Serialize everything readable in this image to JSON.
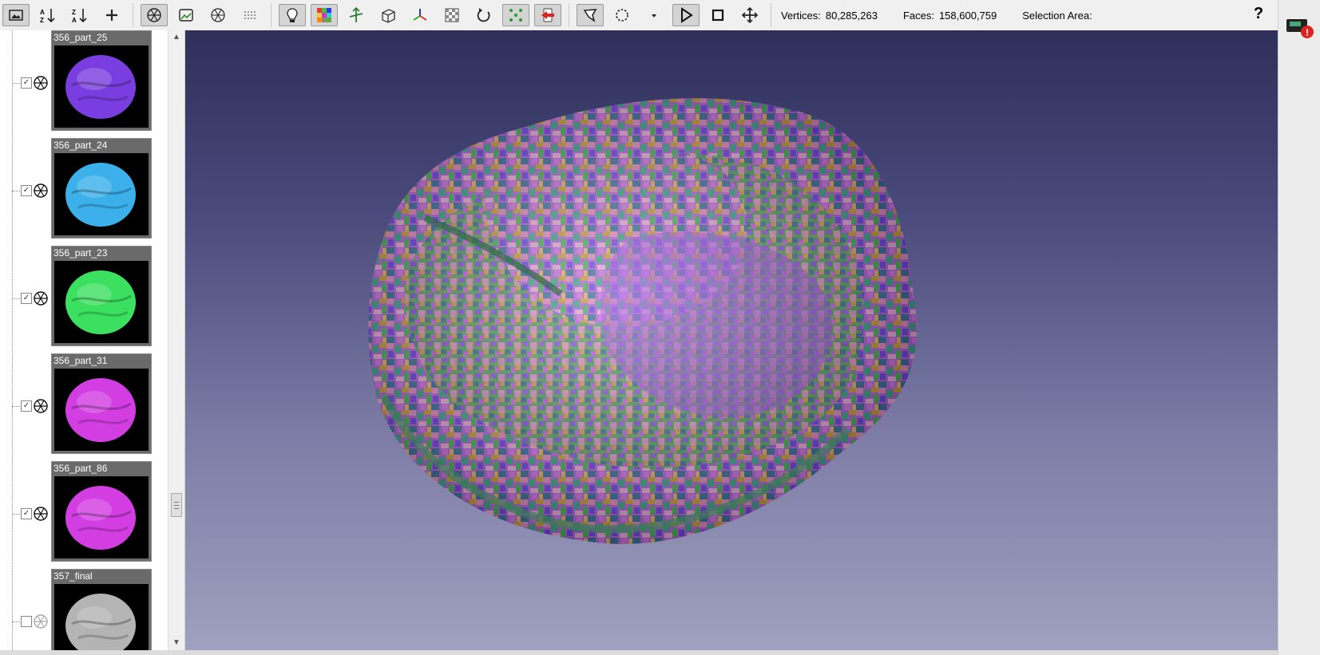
{
  "toolbar": {
    "groups": [
      [
        "image-icon",
        "sort-ascending-icon",
        "sort-descending-icon",
        "plus-icon"
      ],
      [
        "mesh-display-icon",
        "texture-icon",
        "wireframe-icon",
        "points-icon"
      ],
      [
        "light-icon",
        "color-grid-icon",
        "normals-icon",
        "bounding-box-icon",
        "axis-icon",
        "checker-icon",
        "reset-view-icon",
        "vertices-icon",
        "red-select-icon"
      ],
      [
        "lasso-select-icon",
        "circle-select-icon",
        "dropdown-arrow-icon",
        "play-icon",
        "stop-icon",
        "move-icon"
      ]
    ],
    "active_buttons": [
      "image-icon",
      "mesh-display-icon",
      "light-icon",
      "color-grid-icon",
      "vertices-icon",
      "red-select-icon",
      "lasso-select-icon",
      "play-icon"
    ]
  },
  "stats": {
    "vertices_label": "Vertices:",
    "vertices_value": "80,285,263",
    "faces_label": "Faces:",
    "faces_value": "158,600,759",
    "selection_label": "Selection Area:",
    "selection_value": ""
  },
  "help_label": "?",
  "layers": [
    {
      "name": "356_part_25",
      "checked": true,
      "color": "#7a3ee0"
    },
    {
      "name": "356_part_24",
      "checked": true,
      "color": "#3bb0ea"
    },
    {
      "name": "356_part_23",
      "checked": true,
      "color": "#3ce060"
    },
    {
      "name": "356_part_31",
      "checked": true,
      "color": "#d23ee2"
    },
    {
      "name": "356_part_86",
      "checked": true,
      "color": "#d23ee2"
    },
    {
      "name": "357_final",
      "checked": false,
      "color": "#b4b4b4"
    }
  ],
  "scrollbar": {
    "up_icon": "▲",
    "down_icon": "▼",
    "position": 0.79
  }
}
